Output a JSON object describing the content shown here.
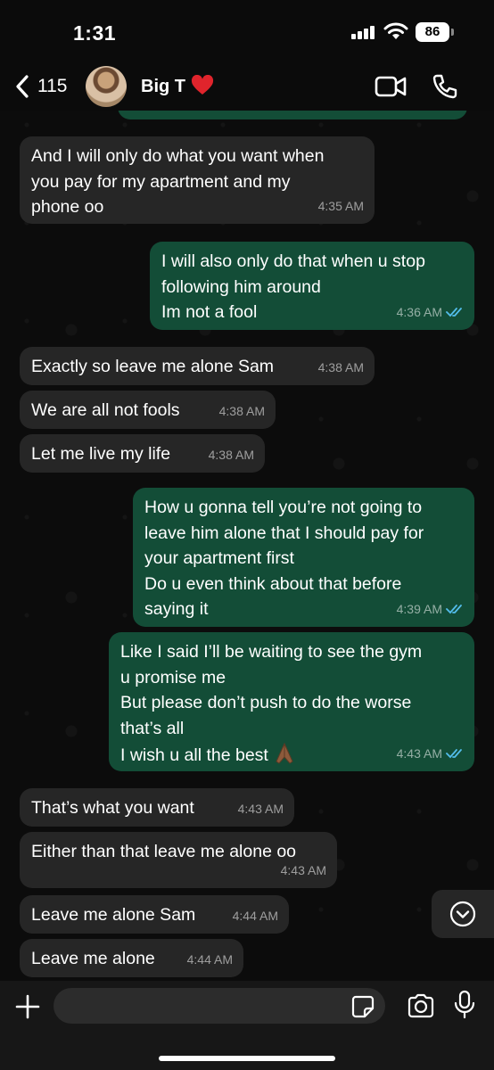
{
  "status_bar": {
    "time": "1:31",
    "battery": "86"
  },
  "header": {
    "back_count": "115",
    "contact_name": "Big T"
  },
  "messages": [
    {
      "direction": "incoming",
      "text": "And I will only do what you want when\nyou pay for my apartment and my\nphone oo",
      "time": "4:35 AM"
    },
    {
      "direction": "outgoing",
      "text": "I will also only do that when u stop\nfollowing him around\nIm not a fool",
      "time": "4:36 AM",
      "read": true
    },
    {
      "direction": "incoming",
      "text": "Exactly so leave me alone Sam",
      "time": "4:38 AM"
    },
    {
      "direction": "incoming",
      "text": "We are all not fools",
      "time": "4:38 AM"
    },
    {
      "direction": "incoming",
      "text": "Let me live my life",
      "time": "4:38 AM"
    },
    {
      "direction": "outgoing",
      "text": "How u gonna tell you’re not going to\nleave him alone that I should pay for\nyour apartment first\nDo u even think about that before\nsaying it",
      "time": "4:39 AM",
      "read": true
    },
    {
      "direction": "outgoing",
      "text": "Like I said I’ll be waiting to see the gym\nu promise me\nBut please don’t push to do the worse\nthat’s all\nI wish u all the best",
      "emoji": "folded-hands",
      "time": "4:43 AM",
      "read": true
    },
    {
      "direction": "incoming",
      "text": "That’s what you want",
      "time": "4:43 AM"
    },
    {
      "direction": "incoming",
      "text": "Either than that leave me alone oo",
      "time": "4:43 AM"
    },
    {
      "direction": "incoming",
      "text": "Leave me alone Sam",
      "time": "4:44 AM"
    },
    {
      "direction": "incoming",
      "text": "Leave me alone",
      "time": "4:44 AM"
    }
  ],
  "input": {
    "value": "",
    "placeholder": ""
  },
  "icons": {
    "back": "chevron-left-icon",
    "heart": "red-heart-icon",
    "video": "video-call-icon",
    "phone": "voice-call-icon",
    "scroll": "scroll-down-icon",
    "plus": "plus-icon",
    "sticker": "sticker-icon",
    "camera": "camera-icon",
    "mic": "microphone-icon",
    "ticks": "double-check-read-icon"
  },
  "colors": {
    "outgoing_bubble": "#134d37",
    "incoming_bubble": "#262626",
    "read_ticks": "#53bdeb",
    "heart": "#e0242c"
  }
}
